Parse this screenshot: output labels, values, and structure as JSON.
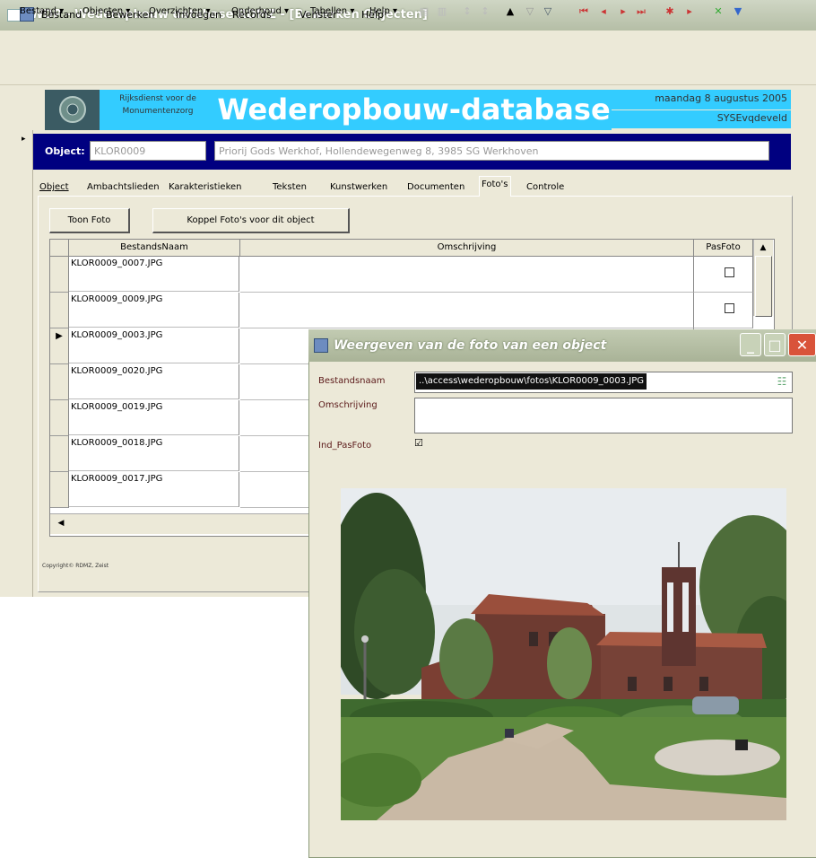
{
  "app": {
    "title": "WDP - Wederopbouw database RDMZ - [Bewerken Objecten]"
  },
  "menu": {
    "items": [
      "Bestand",
      "Bewerken",
      "Invoegen",
      "Records",
      "Venster",
      "Help"
    ]
  },
  "toolbar": {
    "items": [
      "Bestand",
      "Objecten",
      "Overzichten",
      "Onderhoud",
      "Tabellen",
      "Help"
    ]
  },
  "header": {
    "org_line1": "Rijksdienst voor de",
    "org_line2": "Monumentenzorg",
    "title": "Wederopbouw-database",
    "date": "maandag 8 augustus 2005",
    "user": "SYSEvqdeveld"
  },
  "object": {
    "label": "Object:",
    "code": "KLOR0009",
    "description": "Priorij Gods Werkhof, Hollendewegenweg 8, 3985 SG Werkhoven"
  },
  "tabs": [
    "Object",
    "Ambachtslieden",
    "Karakteristieken",
    "Teksten",
    "Kunstwerken",
    "Documenten",
    "Foto's",
    "Controle"
  ],
  "active_tab": "Foto's",
  "buttons": {
    "toon": "Toon Foto",
    "koppel": "Koppel Foto's voor dit object"
  },
  "grid": {
    "headers": [
      "BestandsNaam",
      "Omschrijving",
      "PasFoto"
    ],
    "rows": [
      {
        "file": "KLOR0009_0007.JPG",
        "pasfoto": false
      },
      {
        "file": "KLOR0009_0009.JPG",
        "pasfoto": false
      },
      {
        "file": "KLOR0009_0003.JPG",
        "pasfoto": true
      },
      {
        "file": "KLOR0009_0020.JPG"
      },
      {
        "file": "KLOR0009_0019.JPG"
      },
      {
        "file": "KLOR0009_0018.JPG"
      },
      {
        "file": "KLOR0009_0017.JPG"
      }
    ],
    "current_marker": "▶"
  },
  "footer": {
    "copyright": "Copyright© RDMZ, Zeist"
  },
  "popup": {
    "title": "Weergeven van de foto van een object",
    "bestand_label": "Bestandsnaam",
    "bestand_value": "..\\access\\wederopbouw\\fotos\\KLOR0009_0003.JPG",
    "omschrijving_label": "Omschrijving",
    "pasfoto_label": "Ind_PasFoto",
    "pasfoto_checked": true,
    "check_glyph": "☑"
  },
  "colors": {
    "accent": "#33ccff",
    "object_band": "#000080",
    "window_bg": "#ece9d8"
  }
}
